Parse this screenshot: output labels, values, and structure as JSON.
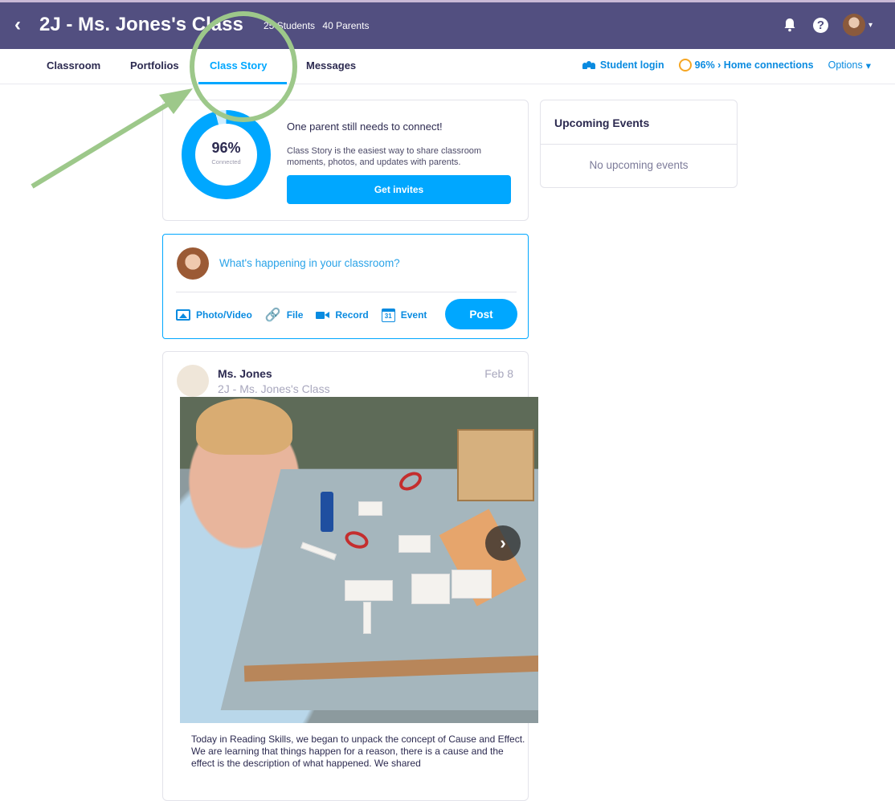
{
  "header": {
    "back_label": "‹",
    "class_name": "2J - Ms. Jones's Class",
    "students": "25 Students",
    "parents": "40 Parents"
  },
  "tabs": [
    {
      "label": "Classroom"
    },
    {
      "label": "Portfolios"
    },
    {
      "label": "Class Story",
      "active": true
    },
    {
      "label": "Messages"
    }
  ],
  "right_links": {
    "student_login": "Student login",
    "home_connections": "96% › Home connections",
    "options": "Options"
  },
  "connect_card": {
    "percent": "96%",
    "percent_value": 0.96,
    "percent_label": "Connected",
    "title": "One parent still needs to connect!",
    "description": "Class Story is the easiest way to share classroom moments, photos, and updates with parents.",
    "button": "Get invites"
  },
  "events_card": {
    "title": "Upcoming Events",
    "empty": "No upcoming events"
  },
  "composer": {
    "placeholder": "What's happening in your classroom?",
    "photo_video": "Photo/Video",
    "file": "File",
    "record": "Record",
    "event": "Event",
    "calendar_day": "31",
    "post": "Post"
  },
  "post": {
    "author": "Ms. Jones",
    "class_name": "2J - Ms. Jones's Class",
    "date": "Feb 8",
    "text_line1": "Today in Reading Skills, we began to unpack the concept of Cause and Effect.",
    "text_line2": "We are learning that things happen for a reason, there is a cause and the effect is the description of what happened. We shared"
  },
  "colors": {
    "header_bg": "#524f80",
    "accent_blue": "#00a7ff",
    "annotation_green": "#9dc88a",
    "connect_ring": "#f6a623"
  }
}
